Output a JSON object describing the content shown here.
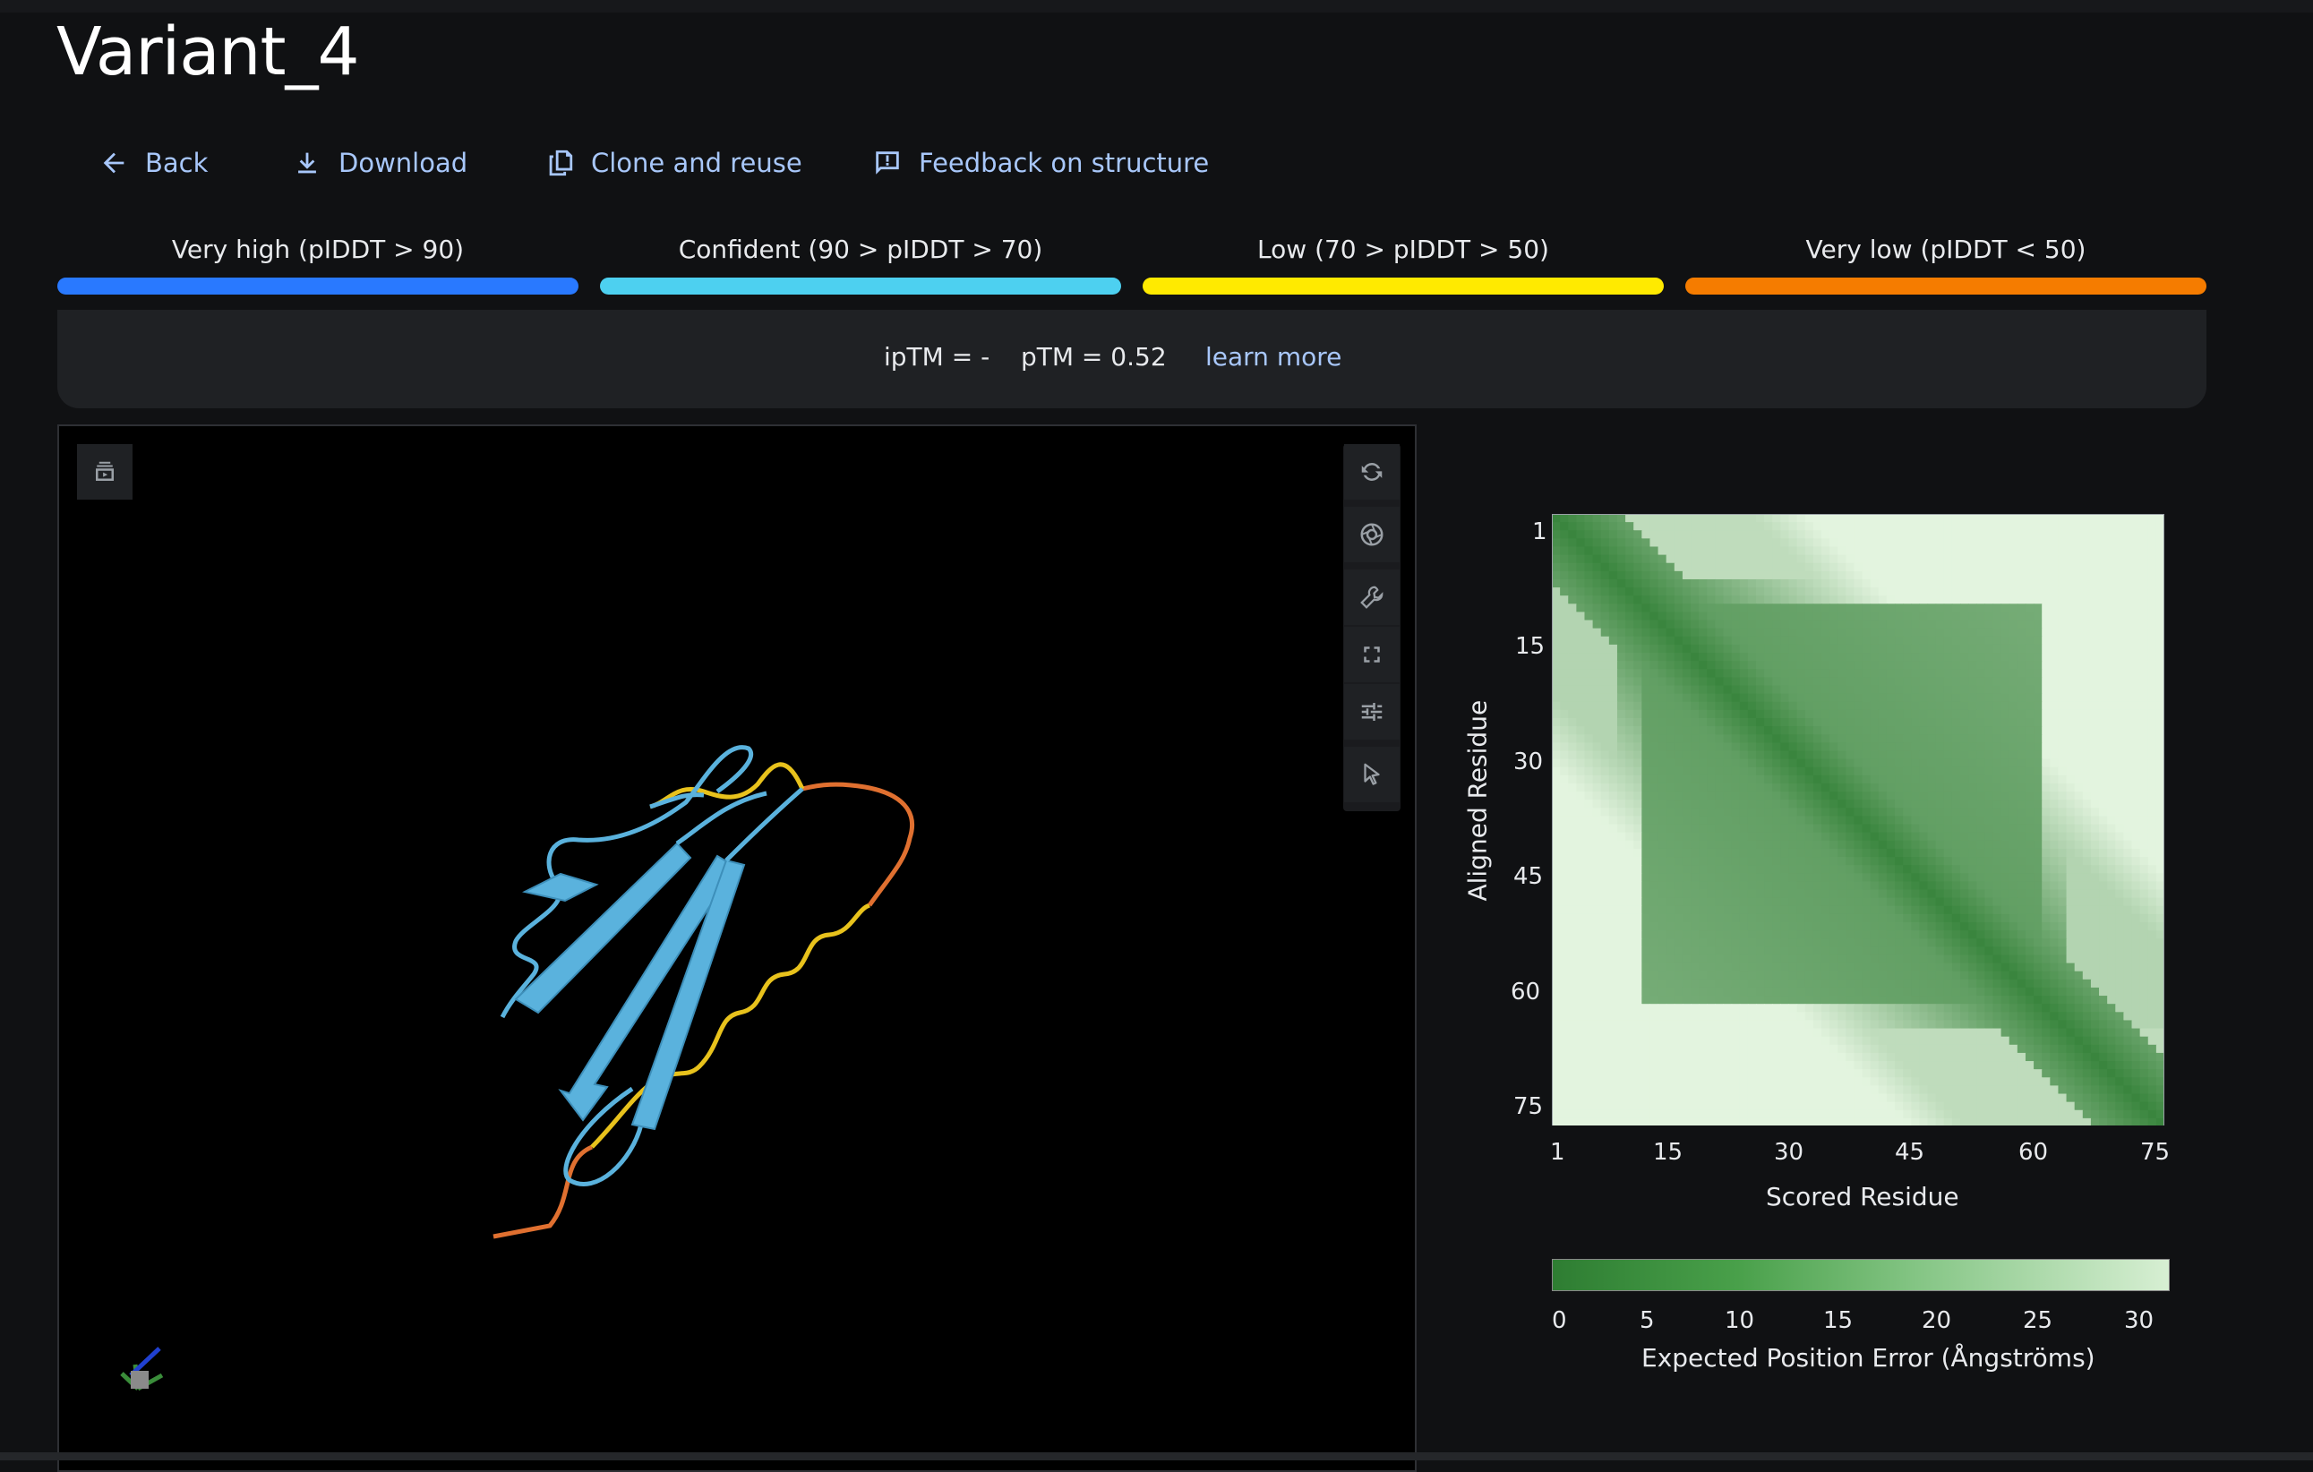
{
  "title": "Variant_4",
  "actions": [
    {
      "label": "Back",
      "icon": "arrow-left-icon"
    },
    {
      "label": "Download",
      "icon": "download-icon"
    },
    {
      "label": "Clone and reuse",
      "icon": "copy-icon"
    },
    {
      "label": "Feedback on structure",
      "icon": "feedback-icon"
    }
  ],
  "legend": [
    {
      "label": "Very high (pIDDT > 90)",
      "color": "#2979ff"
    },
    {
      "label": "Confident (90 > pIDDT > 70)",
      "color": "#4dd0f0"
    },
    {
      "label": "Low (70 > pIDDT > 50)",
      "color": "#ffea00"
    },
    {
      "label": "Very low (pIDDT < 50)",
      "color": "#f57c00"
    }
  ],
  "metrics": {
    "iptm": "ipTM = -",
    "ptm": "pTM = 0.52",
    "learn_more": "learn more"
  },
  "viewer": {
    "left_tool_icon": "animation-icon",
    "right_tool_icons": [
      "rotate-icon",
      "camera-icon",
      "wrench-icon",
      "expand-icon",
      "sliders-icon",
      "pointer-icon"
    ],
    "structure_colors": {
      "confident": "#5ab2dd",
      "low": "#e8c21c",
      "very_low": "#e07030"
    }
  },
  "pae": {
    "y_ticks": [
      "1",
      "15",
      "30",
      "45",
      "60",
      "75"
    ],
    "x_ticks": [
      "1",
      "15",
      "30",
      "45",
      "60",
      "75"
    ],
    "x_label": "Scored Residue",
    "y_label": "Aligned Residue",
    "colorbar_ticks": [
      "0",
      "5",
      "10",
      "15",
      "20",
      "25",
      "30"
    ],
    "colorbar_label": "Expected Position Error (Ångströms)",
    "colors": {
      "low_error": "#2e7d32",
      "high_error": "#e3f4df"
    }
  }
}
